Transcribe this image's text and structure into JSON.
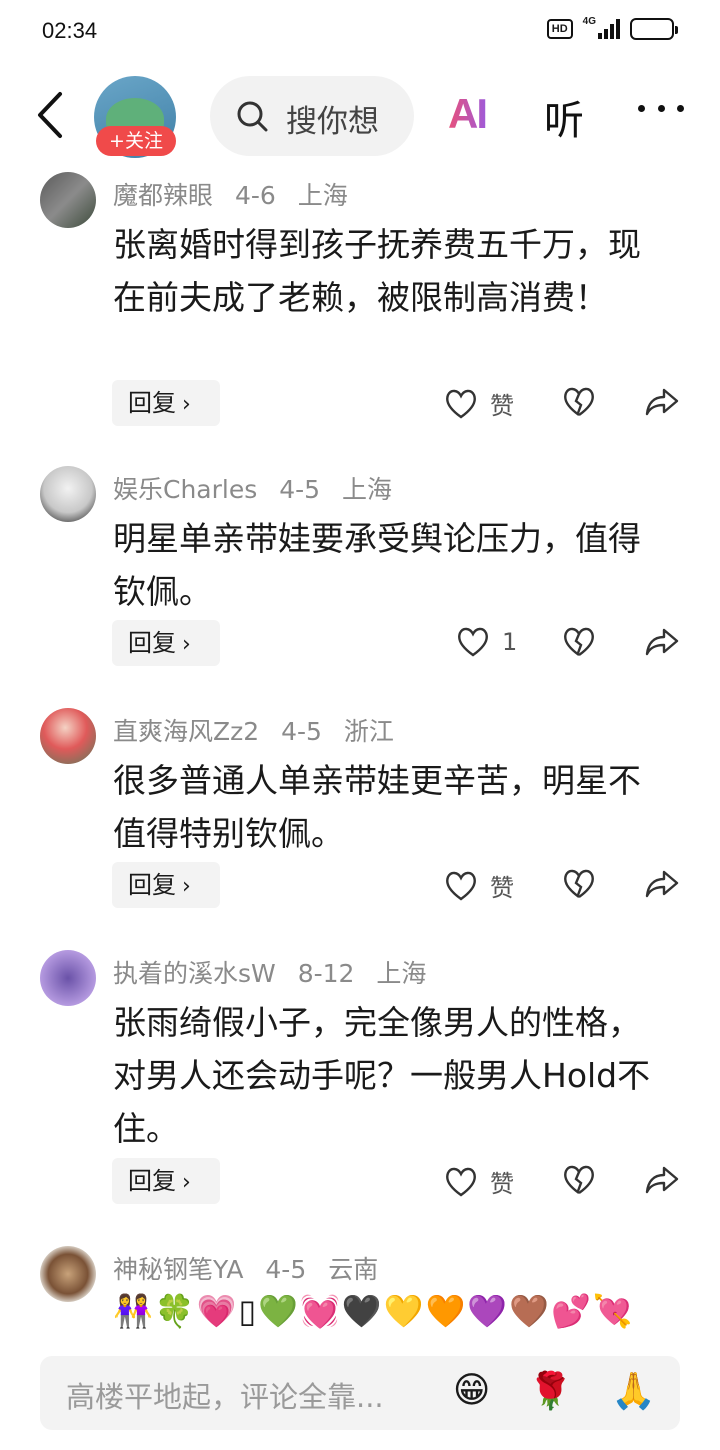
{
  "status_bar": {
    "time": "02:34",
    "hd_label": "HD",
    "network_label": "4G",
    "battery_level": 0.85
  },
  "nav": {
    "follow_label": "+关注",
    "search_placeholder": "搜你想",
    "ai_label": "AI",
    "listen_label": "听",
    "icons": [
      "back-arrow-icon",
      "search-icon",
      "more-icon"
    ]
  },
  "comments": [
    {
      "user": "魔都辣眼",
      "date": "4-6",
      "location": "上海",
      "text": "张离婚时得到孩子抚养费五千万，现在前夫成了老赖，被限制高消费！",
      "reply_label": "回复",
      "like_label": "赞"
    },
    {
      "user": "娱乐Charles",
      "date": "4-5",
      "location": "上海",
      "text": "明星单亲带娃要承受舆论压力，值得钦佩。",
      "reply_label": "回复",
      "like_label": "1"
    },
    {
      "user": "直爽海风Zz2",
      "date": "4-5",
      "location": "浙江",
      "text": "很多普通人单亲带娃更辛苦，明星不值得特别钦佩。",
      "reply_label": "回复",
      "like_label": "赞"
    },
    {
      "user": "执着的溪水sW",
      "date": "8-12",
      "location": "上海",
      "text": "张雨绮假小子，完全像男人的性格，对男人还会动手呢？一般男人Hold不住。",
      "reply_label": "回复",
      "like_label": "赞"
    },
    {
      "user": "神秘钢笔YA",
      "date": "4-5",
      "location": "云南",
      "emojis": "👭🍀💗▯💚💓🖤💛🧡💜🤎💕💘"
    }
  ],
  "bottom_bar": {
    "input_placeholder": "高楼平地起，评论全靠...",
    "emoji_1": "😁",
    "emoji_2": "🌹",
    "emoji_3": "🙏"
  }
}
